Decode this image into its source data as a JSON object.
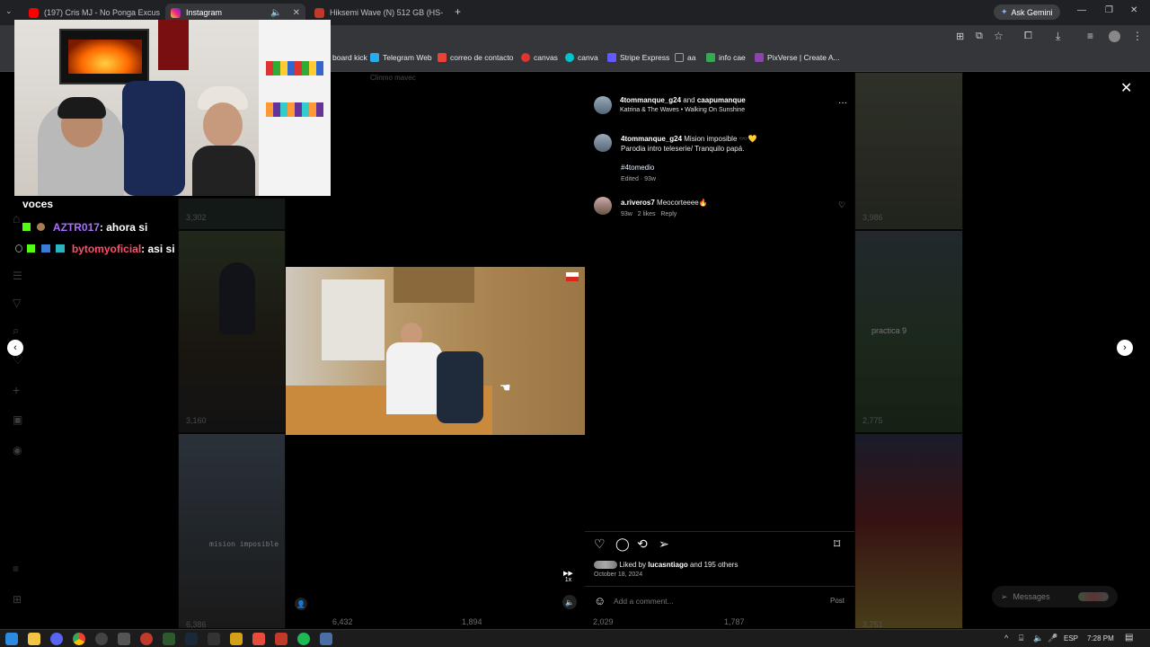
{
  "browser": {
    "tabs": [
      {
        "title": "(197) Cris MJ - No Ponga Excus",
        "color": "#ff0000"
      },
      {
        "title": "Instagram",
        "color": "#d6249f"
      },
      {
        "title": "Hiksemi Wave (N) 512 GB (HS-",
        "color": "#c0392b"
      }
    ],
    "new_tab": "+",
    "ask_gemini": "Ask Gemini",
    "bookmarks": [
      {
        "label": "board kick",
        "color": "#53fc18"
      },
      {
        "label": "Telegram Web",
        "color": "#2aabee"
      },
      {
        "label": "correo de contacto",
        "color": "#ea4335"
      },
      {
        "label": "canvas",
        "color": "#e13333"
      },
      {
        "label": "canva",
        "color": "#00c4cc"
      },
      {
        "label": "Stripe Express",
        "color": "#635bff"
      },
      {
        "label": "aa",
        "color": "#9aa0a6"
      },
      {
        "label": "info cae",
        "color": "#34a853"
      },
      {
        "label": "PixVerse | Create A...",
        "color": "#8e44ad"
      }
    ]
  },
  "stream": {
    "chat": [
      {
        "user": "voces",
        "msg": "",
        "color": "#ffffff"
      },
      {
        "user": "AZTR017",
        "msg": ": ahora si",
        "color": "#a970ff"
      },
      {
        "user": "bytomyoficial",
        "msg": ": asi si",
        "color": "#ff4f6d"
      }
    ],
    "overlay_hint": "Clinmo mavec"
  },
  "grid": {
    "view_counts": [
      "3,302",
      "3,160",
      "6,386",
      "6,432",
      "1,894",
      "2,029",
      "1,787",
      "3,751",
      "3,986",
      "2,775"
    ],
    "overlay_text_left": "mision imposible",
    "overlay_text_right": "practica 9"
  },
  "post": {
    "header_user": "4tommanque_g24",
    "header_and": "and",
    "header_collab": "caapumanque",
    "audio": "Katrina & The Waves • Walking On Sunshine",
    "more": "···",
    "caption_user": "4tommanque_g24",
    "caption_text": "Mision imposible 🕶️💛",
    "caption_line2": "Parodia intro teleserie/ Tranquilo papá.",
    "hashtag": "#4tomedio",
    "caption_meta": "Edited · 93w",
    "comment_user": "a.riveros7",
    "comment_text": "Meocorteeee🔥",
    "comment_time": "93w",
    "comment_likes": "2 likes",
    "comment_reply": "Reply",
    "liked_by_prefix": "Liked by",
    "liked_by_user": "lucasntiago",
    "liked_by_suffix": "and 195 others",
    "date": "October 18, 2024",
    "add_comment_placeholder": "Add a comment...",
    "post_button": "Post"
  },
  "messages_label": "Messages",
  "taskbar": {
    "lang": "ESP",
    "time": "7:28 PM"
  }
}
